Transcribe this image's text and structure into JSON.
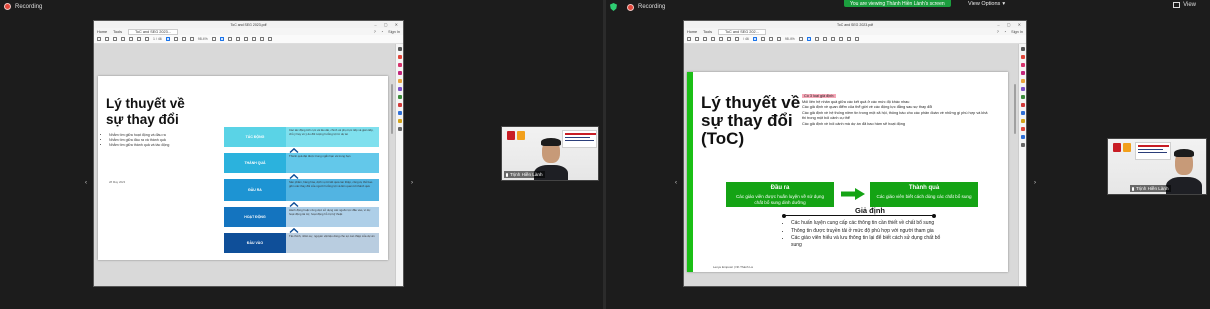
{
  "left": {
    "recording_label": "Recording",
    "pdf": {
      "title": "ToC and SEG 2023.pdf",
      "menu": [
        "Home",
        "Tools"
      ],
      "tab": "ToC and SEG 2023...",
      "sign_in": "Sign In",
      "page_num": "1 / 46",
      "zoom": "98.4%"
    },
    "slide": {
      "title_line1": "Lý thuyết về",
      "title_line2": "sự thay đổi",
      "bullets": [
        "Nhằm tìm giữa hoạt động và đầu ra",
        "Nhằm tìm giữa đầu ra và thành quả",
        "Nhằm tìm giữa thành quả và tác động"
      ],
      "date": "28 May 2023",
      "rows": [
        {
          "label": "TÁC ĐỘNG",
          "text": "Các tác động tích cực và lâu dài, chính và phụ trực tiếp và gián tiếp, chủ ý hay vô ý do đối tượng hưởng lợi từ dự án",
          "color": "#5ad3e6"
        },
        {
          "label": "THÀNH QUẢ",
          "text": "Thành quả đạt được trong ngắn hạn và trung hạn",
          "color": "#2bb2dd"
        },
        {
          "label": "ĐẦU RA",
          "text": "Sản phẩm, hàng hóa, dịch vụ từ kết quả can thiệp, công cụ thể bao gồm các thay đổi của người hưởng lợi và liên quan tới thành quả",
          "color": "#1d94d3"
        },
        {
          "label": "HOẠT ĐỘNG",
          "text": "Hành động hoặc công việc sử dụng các nguồn lực đầu vào, ví dụ: hoạt động tài trợ, hoạt động hỗ trợ kỹ thuật",
          "color": "#1474bf"
        },
        {
          "label": "ĐẦU VÀO",
          "text": "Tài chính, nhân sự, nguyên vật liệu dùng cho sự can thiệp của dự án",
          "color": "#0f4f99"
        }
      ]
    },
    "cam": {
      "name": "Trịnh Hiền Lành"
    }
  },
  "right": {
    "recording_label": "Recording",
    "viewing_banner": "You are viewing Thành Hiền Lành's screen",
    "view_options": "View Options",
    "view_label": "View",
    "pdf": {
      "title": "ToC and SEG 2023.pdf",
      "menu": [
        "Home",
        "Tools"
      ],
      "tab": "ToC and SEG 202...",
      "sign_in": "Sign In",
      "page_num": "/ 46",
      "zoom": "98.4%"
    },
    "slide": {
      "title_line1": "Lý thuyết về",
      "title_line2": "sự thay đổi",
      "title_line3": "(ToC)",
      "assump_tag": "Có 3 loại giả định:",
      "assumptions": [
        "Mối liên hệ nhân quả giữa các kết quả ở các mức độ khác nhau",
        "Các giả định về quan điểm của thể giới về các động lực đằng sau sự thay đổi",
        "Các giả định về hệ thống niềm tin trong một xã hội, thông báo cho các phân đoán về những gì phù hợp và khả thi trong một bối cảnh cụ thể",
        "Các giả định về bối cảnh mà dự án đã bao hàm sẽ hoạt động"
      ],
      "box1_title": "Đầu ra",
      "box1_body": "Các giáo viên được huấn luyện về sử dụng chất bổ sung dinh dưỡng",
      "box2_title": "Thành quả",
      "box2_body": "Các giáo viên biết cách dùng các chất bổ sung",
      "gd_title": "Giả định",
      "gd_items": [
        "Các huấn luyện cung cấp các thông tin cần thiết về chất bổ sung",
        "Thông tin được truyền tải ở mức độ phù hợp với người tham gia",
        "Các giáo viên hiểu và lưu thông tin lại để biết cách sử dụng chất bổ sung"
      ],
      "footer": "Lenye Empowr | Nh Thành Lá"
    },
    "cam": {
      "name": "Trịnh Hiền Lành"
    }
  }
}
